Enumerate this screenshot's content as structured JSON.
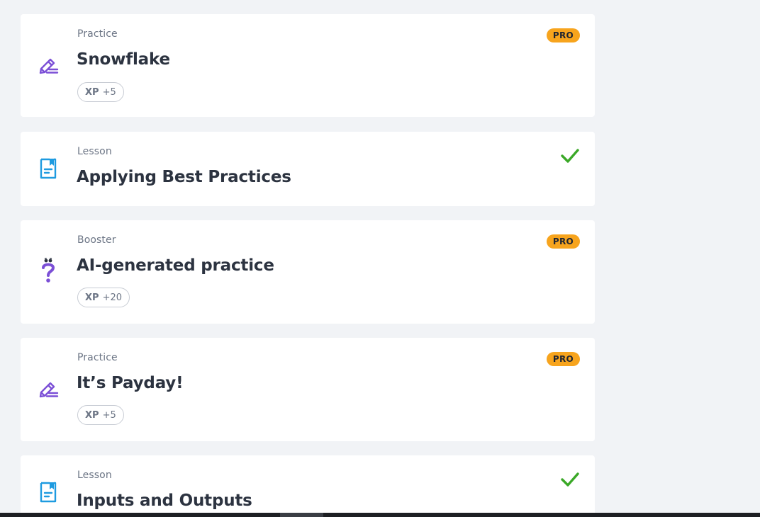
{
  "cards": [
    {
      "type": "Practice",
      "title": "Snowflake",
      "xp_label": "XP",
      "xp": "+5",
      "badge": "PRO",
      "icon": "pencil-icon"
    },
    {
      "type": "Lesson",
      "title": "Applying Best Practices",
      "status": "completed",
      "icon": "lesson-icon"
    },
    {
      "type": "Booster",
      "title": "AI-generated practice",
      "xp_label": "XP",
      "xp": "+20",
      "badge": "PRO",
      "icon": "question-icon"
    },
    {
      "type": "Practice",
      "title": "It’s Payday!",
      "xp_label": "XP",
      "xp": "+5",
      "badge": "PRO",
      "icon": "pencil-icon"
    },
    {
      "type": "Lesson",
      "title": "Inputs and Outputs",
      "status": "completed",
      "icon": "lesson-icon"
    }
  ],
  "colors": {
    "pro_badge": "#f7a41d",
    "practice_icon": "#7b4fd6",
    "lesson_icon": "#1e9be0",
    "check": "#3aa827"
  }
}
